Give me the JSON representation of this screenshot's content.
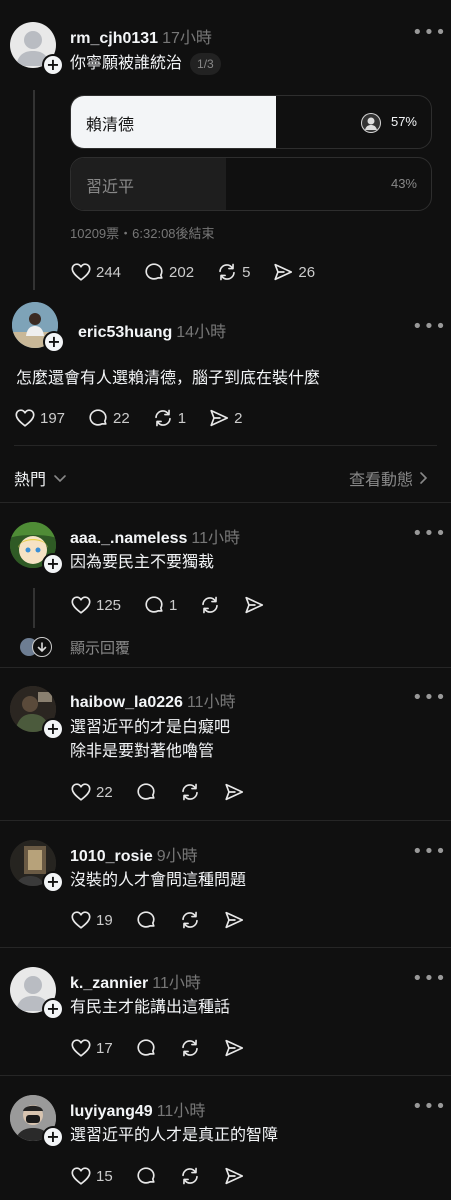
{
  "post": {
    "username": "rm_cjh0131",
    "time": "17小時",
    "text": "你寧願被誰統治",
    "page_badge": "1/3",
    "poll": {
      "options": [
        {
          "label": "賴清德",
          "percent": "57%",
          "value": 0.57,
          "voted": true
        },
        {
          "label": "習近平",
          "percent": "43%",
          "value": 0.43,
          "voted": false
        }
      ],
      "meta": "10209票・6:32:08後結束"
    },
    "actions": {
      "likes": "244",
      "replies": "202",
      "reposts": "5",
      "shares": "26"
    }
  },
  "reply": {
    "username": "eric53huang",
    "time": "14小時",
    "text": "怎麼還會有人選賴清德，腦子到底在裝什麼",
    "actions": {
      "likes": "197",
      "replies": "22",
      "reposts": "1",
      "shares": "2"
    }
  },
  "sort": {
    "label": "熱門",
    "activity_link": "查看動態"
  },
  "comments": [
    {
      "username": "aaa._.nameless",
      "time": "11小時",
      "lines": [
        "因為要民主不要獨裁"
      ],
      "likes": "125",
      "replies": "1",
      "show_replies": "顯示回覆"
    },
    {
      "username": "haibow_la0226",
      "time": "11小時",
      "lines": [
        "選習近平的才是白癡吧",
        "除非是要對著他嚕管"
      ],
      "likes": "22"
    },
    {
      "username": "1010_rosie",
      "time": "9小時",
      "lines": [
        "沒裝的人才會問這種問題"
      ],
      "likes": "19"
    },
    {
      "username": "k._zannier",
      "time": "11小時",
      "lines": [
        "有民主才能講出這種話"
      ],
      "likes": "17"
    },
    {
      "username": "luyiyang49",
      "time": "11小時",
      "lines": [
        "選習近平的人才是真正的智障"
      ],
      "likes": "15"
    }
  ],
  "colors": {
    "background": "#101010",
    "text": "#f3f5f7",
    "muted": "#777777",
    "poll_selected": "#f3f5f7"
  }
}
